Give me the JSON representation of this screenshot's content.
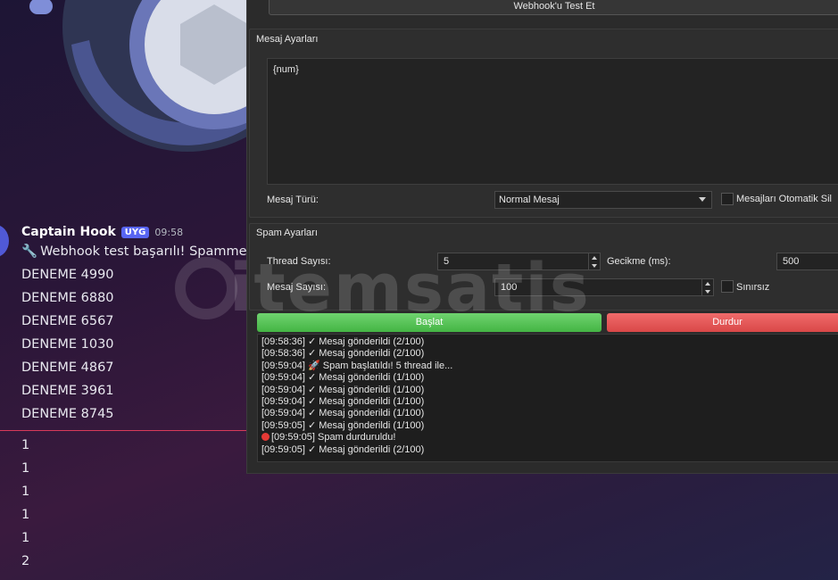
{
  "discord": {
    "author": "Captain Hook",
    "badge": "UYG",
    "time": "09:58",
    "first_line": "Webhook test başarılı! Spammer h",
    "messages": [
      "DENEME 4990",
      "DENEME 6880",
      "DENEME 6567",
      "DENEME 1030",
      "DENEME 4867",
      "DENEME 3961",
      "DENEME 8745"
    ],
    "after_divider": [
      "1",
      "1",
      "1",
      "1",
      "1",
      "2"
    ]
  },
  "app": {
    "test_button": "Webhook'u Test Et",
    "message_group_title": "Mesaj Ayarları",
    "message_text": "{num}",
    "message_type_label": "Mesaj Türü:",
    "message_type_value": "Normal Mesaj",
    "auto_delete_label": "Mesajları Otomatik Sil",
    "spam_group_title": "Spam Ayarları",
    "thread_label": "Thread Sayısı:",
    "thread_value": "5",
    "delay_label": "Gecikme (ms):",
    "delay_value": "500",
    "count_label": "Mesaj Sayısı:",
    "count_value": "100",
    "unlimited_label": "Sınırsız",
    "start_button": "Başlat",
    "stop_button": "Durdur",
    "log": [
      "[09:58:36] ✓ Mesaj gönderildi (2/100)",
      "[09:58:36] ✓ Mesaj gönderildi (2/100)",
      "[09:59:04] 🚀 Spam başlatıldı! 5 thread ile...",
      "[09:59:04] ✓ Mesaj gönderildi (1/100)",
      "[09:59:04] ✓ Mesaj gönderildi (1/100)",
      "[09:59:04] ✓ Mesaj gönderildi (1/100)",
      "[09:59:04] ✓ Mesaj gönderildi (1/100)",
      "[09:59:05] ✓ Mesaj gönderildi (1/100)",
      "[09:59:05] Spam durduruldu!",
      "[09:59:05] ✓ Mesaj gönderildi (2/100)"
    ]
  },
  "watermark": "itemsatis",
  "colors": {
    "start": "#4cbb4c",
    "stop": "#e05252",
    "badge": "#5865f2",
    "divider": "#d83a5a"
  }
}
